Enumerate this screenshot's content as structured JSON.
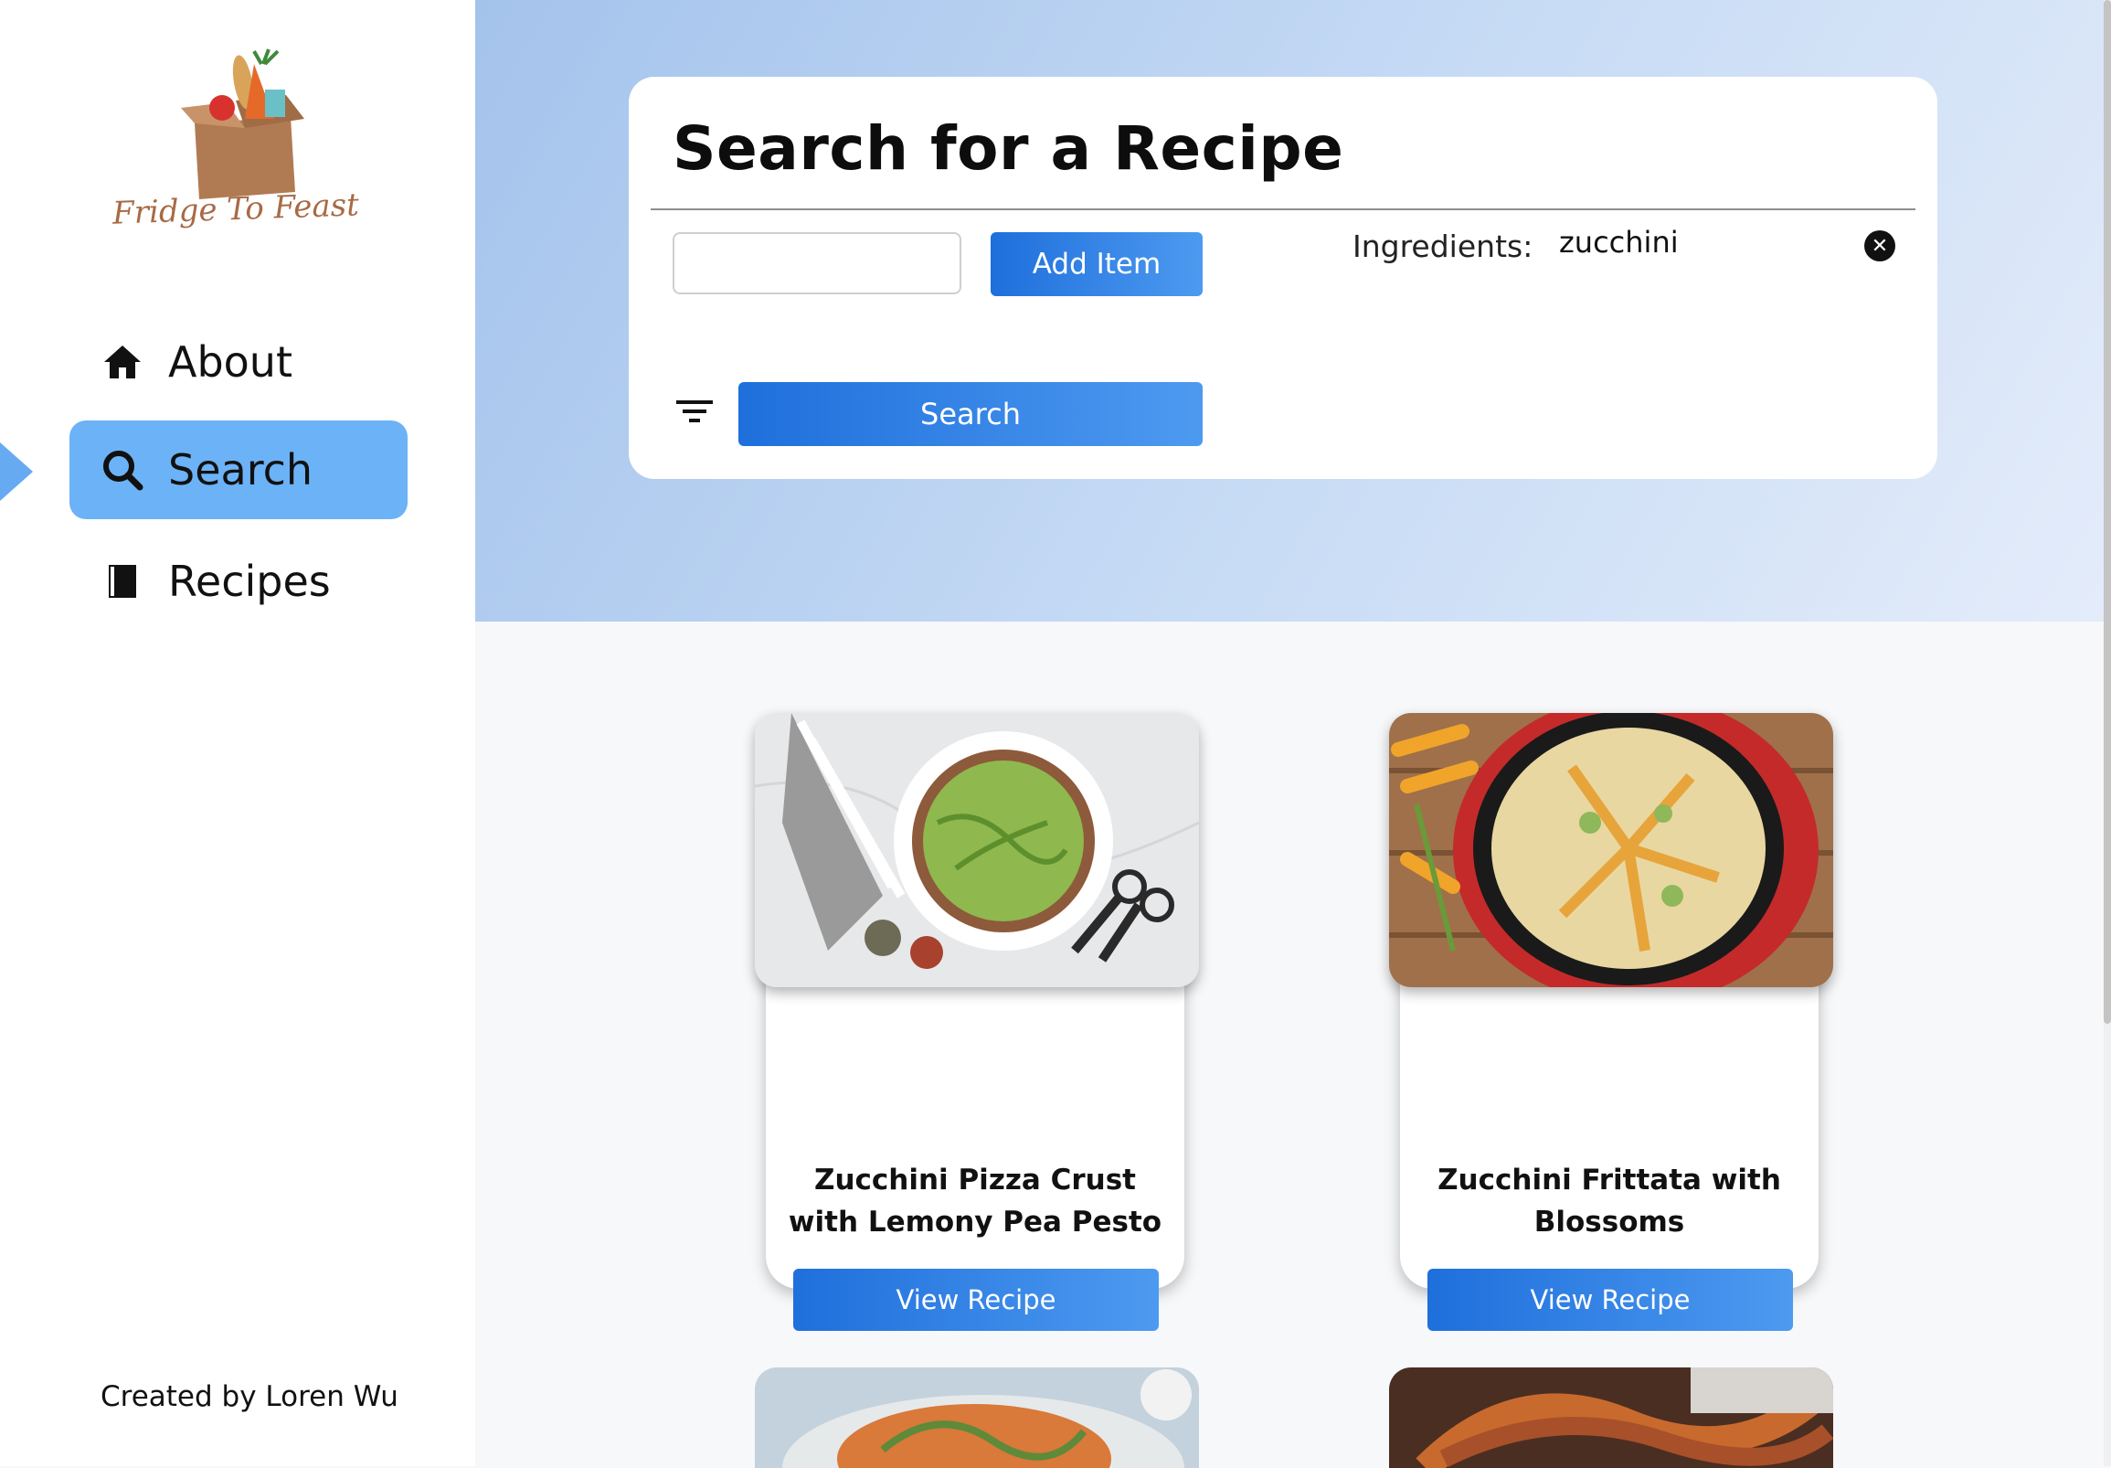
{
  "app": {
    "name": "Fridge To Feast",
    "credit": "Created by Loren Wu"
  },
  "nav": {
    "items": [
      {
        "label": "About",
        "icon": "home-icon",
        "active": false
      },
      {
        "label": "Search",
        "icon": "search-icon",
        "active": true
      },
      {
        "label": "Recipes",
        "icon": "book-icon",
        "active": false
      }
    ]
  },
  "search_card": {
    "title": "Search for a Recipe",
    "input_value": "",
    "add_button": "Add Item",
    "search_button": "Search",
    "ingredients_label": "Ingredients:",
    "ingredients": [
      "zucchini"
    ]
  },
  "recipes": [
    {
      "title": "Zucchini Pizza Crust with Lemony Pea Pesto",
      "button": "View Recipe"
    },
    {
      "title": "Zucchini Frittata with Blossoms",
      "button": "View Recipe"
    }
  ],
  "colors": {
    "accent": "#2a7de6",
    "nav_active": "#6cb2f6",
    "banner": "#b3cdf0"
  }
}
